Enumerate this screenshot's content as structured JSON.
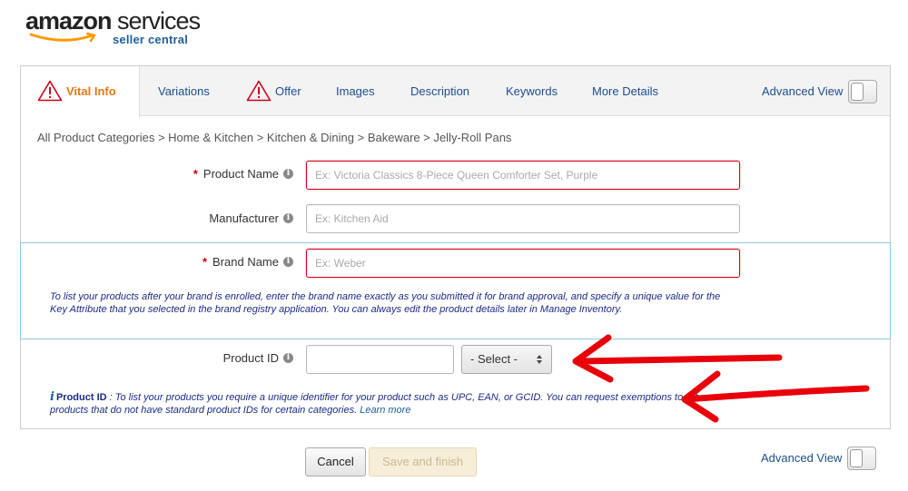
{
  "logo": {
    "brand": "amazon",
    "product": "services",
    "sub": "seller central"
  },
  "tabs": [
    {
      "label": "Vital Info",
      "warning": true,
      "active": true
    },
    {
      "label": "Variations",
      "warning": false
    },
    {
      "label": "Offer",
      "warning": true
    },
    {
      "label": "Images",
      "warning": false
    },
    {
      "label": "Description",
      "warning": false
    },
    {
      "label": "Keywords",
      "warning": false
    },
    {
      "label": "More Details",
      "warning": false
    }
  ],
  "advanced_view_label": "Advanced View",
  "breadcrumb": "All Product Categories > Home & Kitchen > Kitchen & Dining > Bakeware > Jelly-Roll Pans",
  "form": {
    "product_name": {
      "label": "Product Name",
      "required": "*",
      "placeholder": "Ex: Victoria Classics 8-Piece Queen Comforter Set, Purple",
      "value": ""
    },
    "manufacturer": {
      "label": "Manufacturer",
      "placeholder": "Ex: Kitchen Aid",
      "value": ""
    },
    "brand_name": {
      "label": "Brand Name",
      "required": "*",
      "placeholder": "Ex: Weber",
      "value": ""
    },
    "brand_note": "To list your products after your brand is enrolled, enter the brand name exactly as you submitted it for brand approval, and specify a unique value for the Key Attribute that you selected in the brand registry application. You can always edit the product details later in Manage Inventory.",
    "product_id": {
      "label": "Product ID",
      "value": "",
      "select_value": "- Select -"
    },
    "product_id_note": {
      "icon": "i",
      "title": "Product ID",
      "separator": " : ",
      "text": "To list your products you require a unique identifier for your product such as UPC, EAN, or GCID. You can request exemptions to list products that do not have standard product IDs for certain categories.",
      "link": "Learn more"
    }
  },
  "info_icon": "i",
  "buttons": {
    "cancel": "Cancel",
    "save": "Save and finish"
  },
  "colors": {
    "tab_active": "#e47911",
    "link": "#1e4e8c",
    "error": "#d0021b",
    "annotation_arrow": "#e8000b"
  }
}
